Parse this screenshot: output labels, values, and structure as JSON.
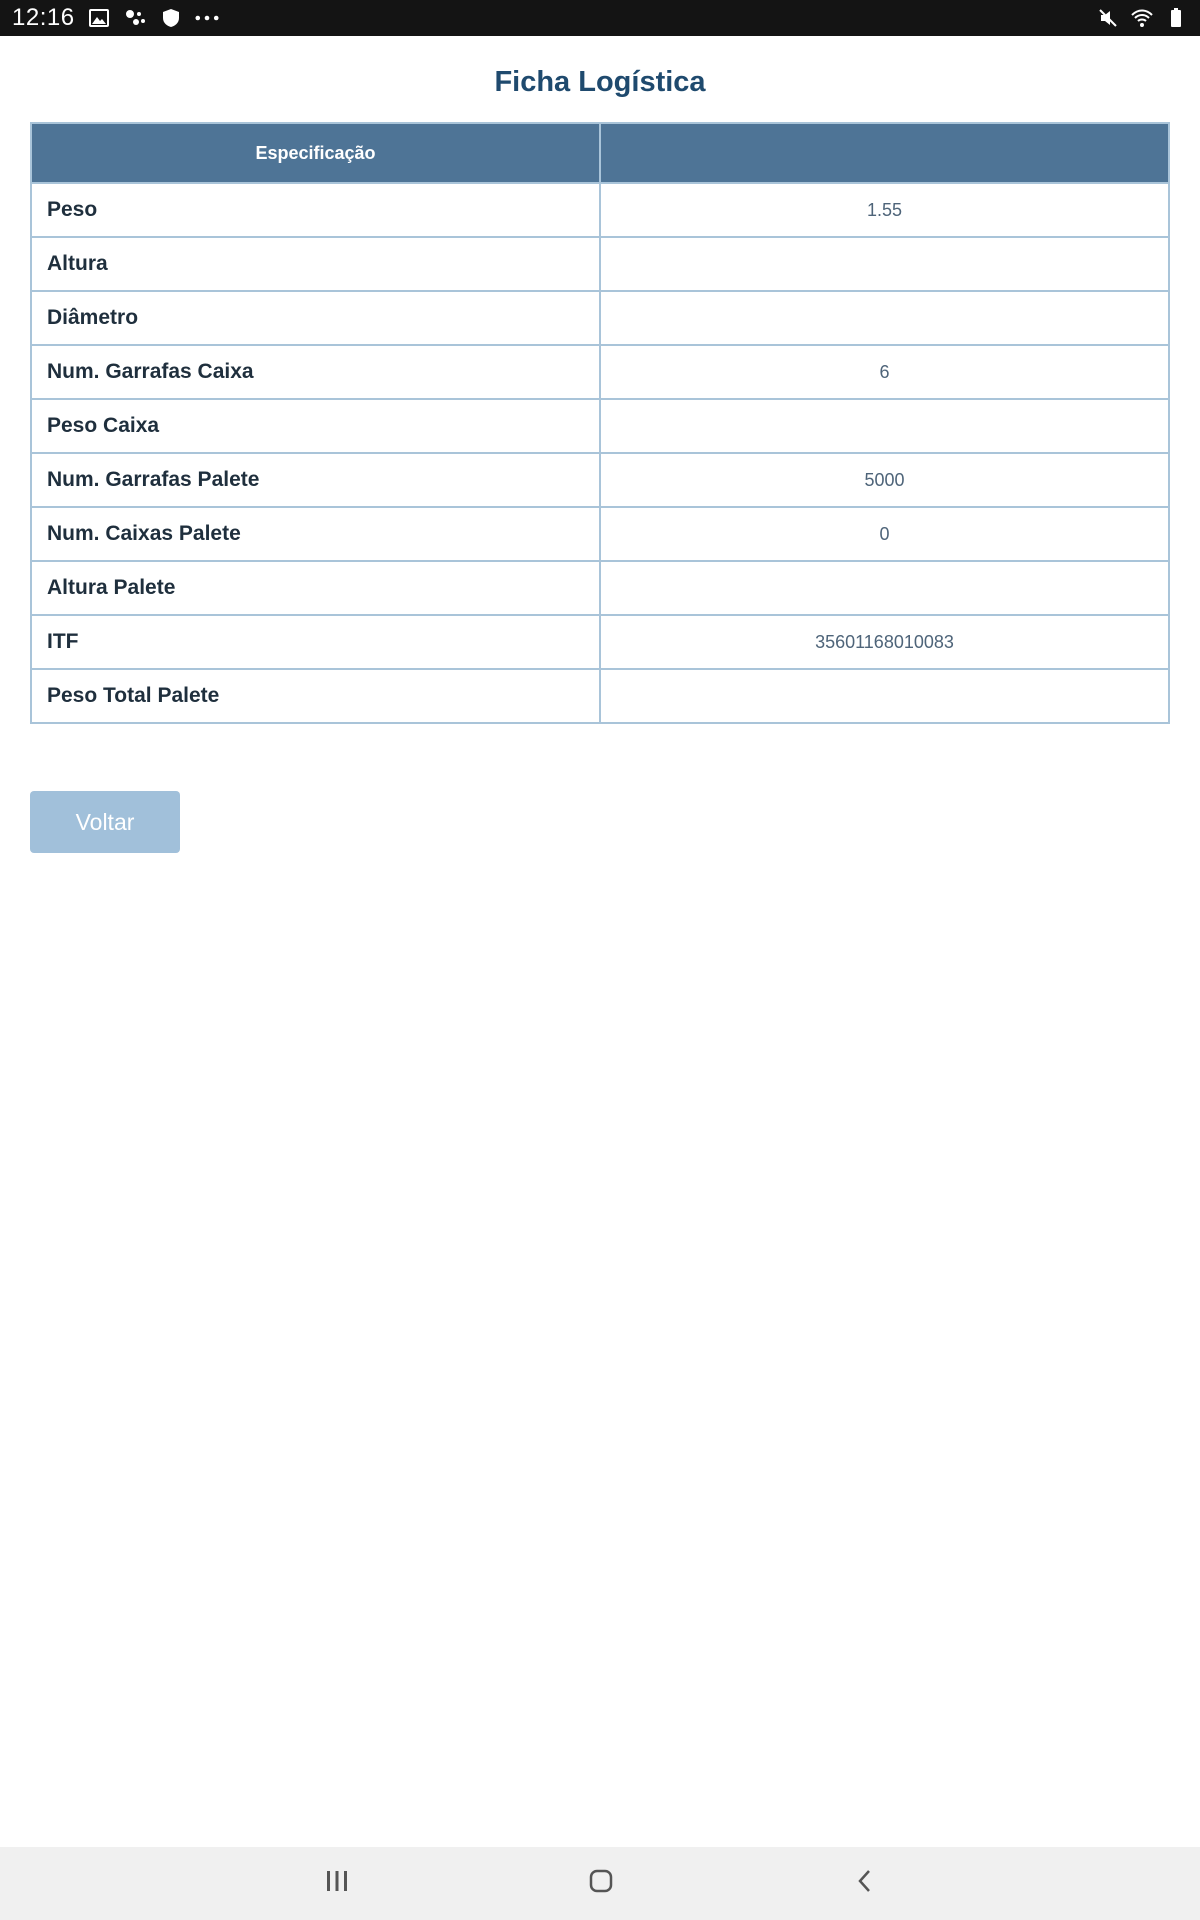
{
  "status_bar": {
    "time": "12:16",
    "left_icons": [
      "image-icon",
      "assistant-icon",
      "shield-icon",
      "more-dots-icon"
    ],
    "right_icons": [
      "mute-icon",
      "wifi-icon",
      "battery-icon"
    ]
  },
  "page": {
    "title": "Ficha Logística"
  },
  "table": {
    "headers": [
      "Especificação",
      ""
    ],
    "rows": [
      {
        "label": "Peso",
        "value": "1.55"
      },
      {
        "label": "Altura",
        "value": ""
      },
      {
        "label": "Diâmetro",
        "value": ""
      },
      {
        "label": "Num. Garrafas Caixa",
        "value": "6"
      },
      {
        "label": "Peso Caixa",
        "value": ""
      },
      {
        "label": "Num. Garrafas Palete",
        "value": "5000"
      },
      {
        "label": "Num. Caixas Palete",
        "value": "0"
      },
      {
        "label": "Altura Palete",
        "value": ""
      },
      {
        "label": "ITF",
        "value": "35601168010083"
      },
      {
        "label": "Peso Total Palete",
        "value": ""
      }
    ]
  },
  "actions": {
    "back_label": "Voltar"
  },
  "nav_bar": {
    "buttons": [
      "recent-apps-icon",
      "home-icon",
      "back-icon"
    ]
  },
  "colors": {
    "title": "#1f4a6e",
    "header_bg": "#4e7496",
    "border": "#a9c4d9",
    "button_bg": "#a1c0da"
  }
}
